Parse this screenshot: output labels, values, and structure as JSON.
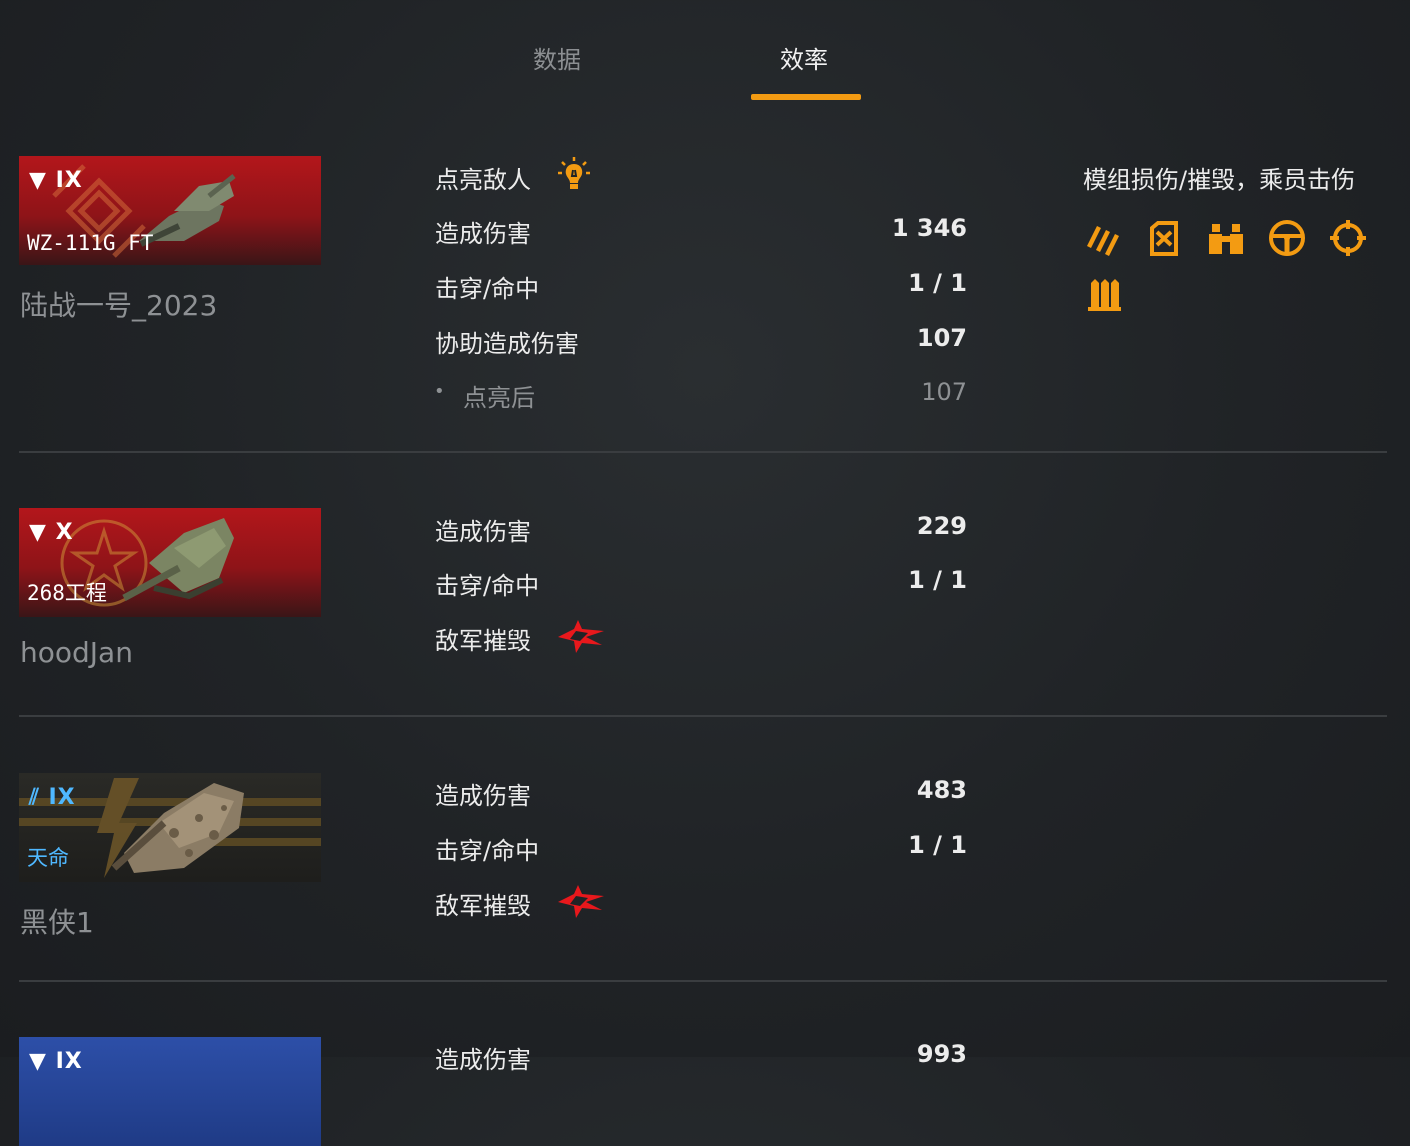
{
  "tabs": [
    {
      "label": "数据",
      "active": false
    },
    {
      "label": "效率",
      "active": true
    }
  ],
  "accent_color": "#f39b12",
  "kill_icon_color": "#e8181c",
  "entries": [
    {
      "tier": "IX",
      "tier_icon": "down-triangle-icon",
      "tank": "WZ-111G FT",
      "player": "陆战一号_2023",
      "stats": [
        {
          "label": "点亮敌人",
          "value": "",
          "icon": "lightbulb-icon"
        },
        {
          "label": "造成伤害",
          "value": "1 346"
        },
        {
          "label": "击穿/命中",
          "value": "1 / 1"
        },
        {
          "label": "协助造成伤害",
          "value": "107"
        },
        {
          "label": "点亮后",
          "value": "107",
          "sub": true
        }
      ],
      "criticals_title": "模组损伤/摧毁，乘员击伤",
      "criticals": [
        "tracks-icon",
        "fuel-tank-icon",
        "binoculars-icon",
        "steering-wheel-icon",
        "gunsight-icon",
        "ammo-rack-icon"
      ]
    },
    {
      "tier": "X",
      "tier_icon": "down-triangle-icon",
      "tank": "268工程",
      "player": "hoodJan",
      "stats": [
        {
          "label": "造成伤害",
          "value": "229"
        },
        {
          "label": "击穿/命中",
          "value": "1 / 1"
        },
        {
          "label": "敌军摧毁",
          "value": "",
          "icon": "destroyed-icon"
        }
      ]
    },
    {
      "tier": "IX",
      "tier_icon": "collector-icon",
      "tank": "天命",
      "player": "黑侠1",
      "stats": [
        {
          "label": "造成伤害",
          "value": "483"
        },
        {
          "label": "击穿/命中",
          "value": "1 / 1"
        },
        {
          "label": "敌军摧毁",
          "value": "",
          "icon": "destroyed-icon"
        }
      ]
    },
    {
      "tier": "IX",
      "tier_icon": "down-triangle-icon",
      "tank": "",
      "player": "",
      "stats": [
        {
          "label": "造成伤害",
          "value": "993"
        }
      ]
    }
  ]
}
